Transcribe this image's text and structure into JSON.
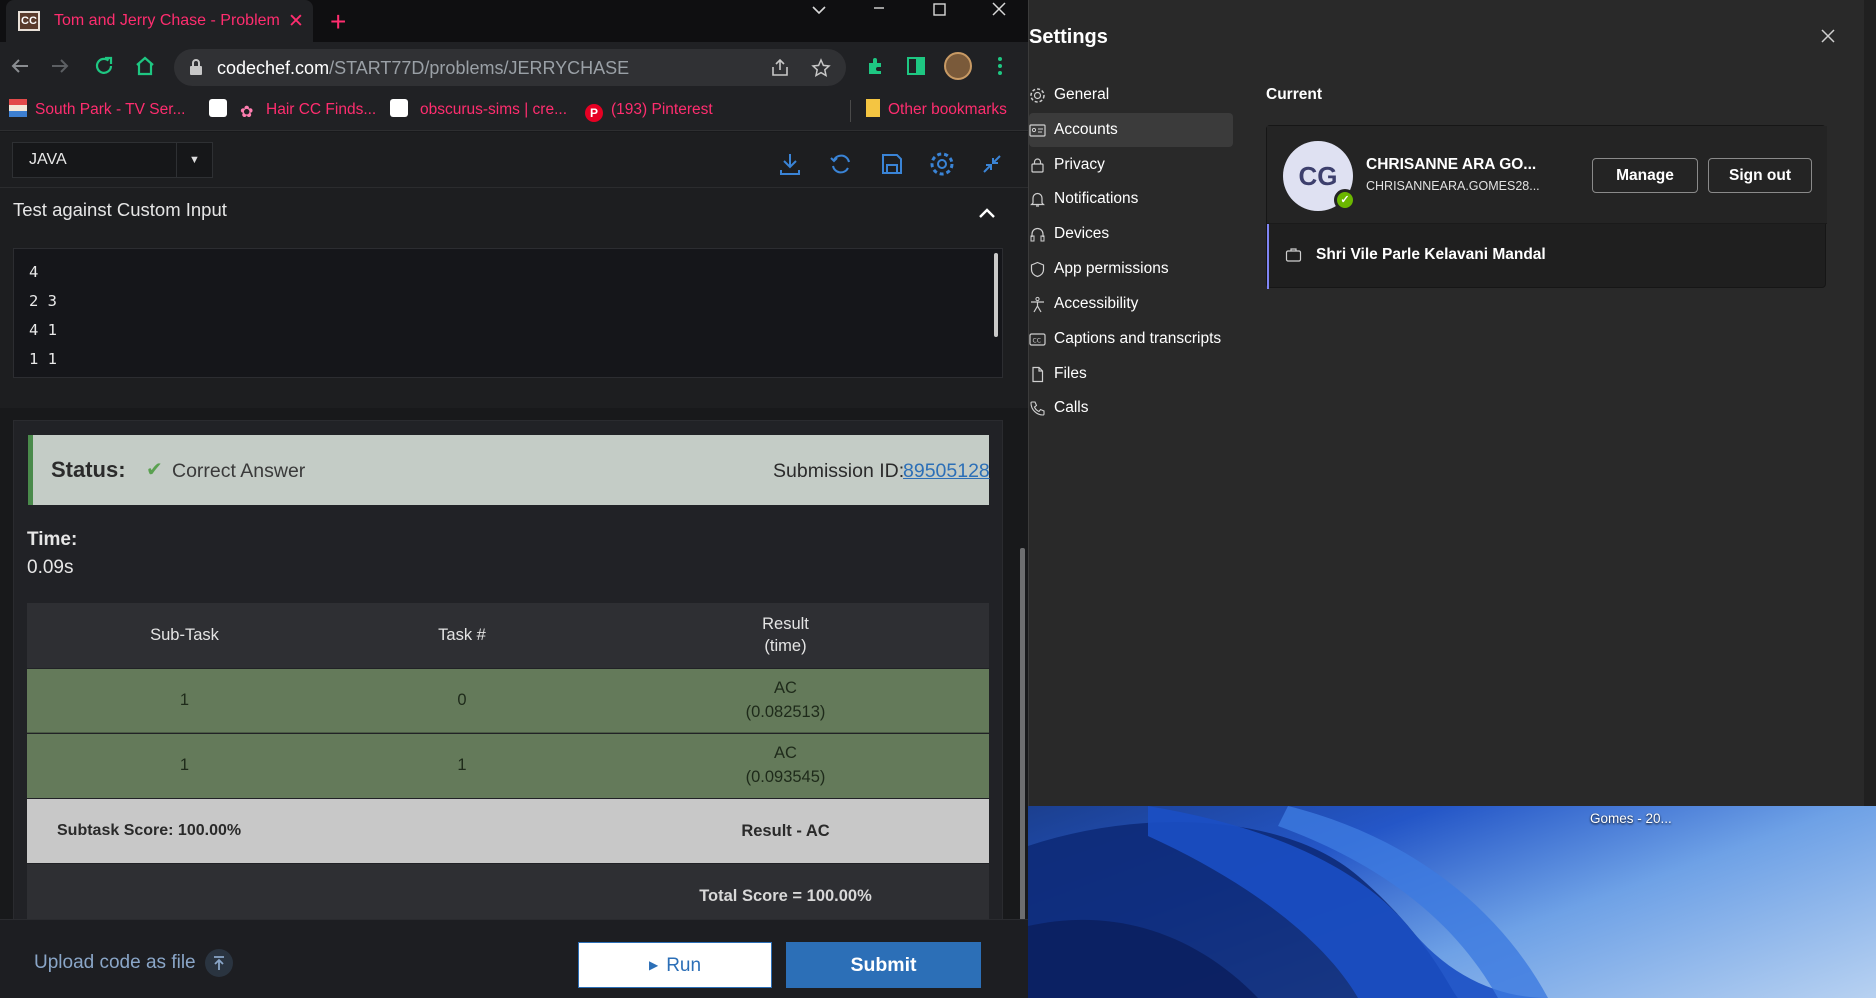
{
  "browser": {
    "tab_title": "Tom and Jerry Chase - Problems",
    "tab_favicon": "CC",
    "address": {
      "host": "codechef.com",
      "path": "/START77D/problems/JERRYCHASE"
    },
    "bookmarks": [
      {
        "label": "South Park - TV Ser...",
        "icon": "south-park-icon"
      },
      {
        "label": "",
        "icon": "patreon-icon"
      },
      {
        "label": "Hair CC Finds...",
        "icon": "flower-icon"
      },
      {
        "label": "",
        "icon": "patreon-icon"
      },
      {
        "label": "obscurus-sims | cre...",
        "icon": "patreon-icon"
      },
      {
        "label": "(193) Pinterest",
        "icon": "pinterest-icon"
      }
    ],
    "other_bookmarks": "Other bookmarks",
    "accent": "#ff2d6f"
  },
  "editor": {
    "language": "JAVA",
    "custom_input_title": "Test against Custom Input",
    "input_lines": [
      "4",
      "2 3",
      "4 1",
      "1 1"
    ]
  },
  "result": {
    "status_label": "Status:",
    "status_value": "Correct Answer",
    "submission_label": "Submission ID:",
    "submission_id": "89505128",
    "time_label": "Time:",
    "time_value": "0.09s",
    "table": {
      "headers": [
        "Sub-Task",
        "Task #",
        "Result"
      ],
      "header_sub": "(time)",
      "rows": [
        {
          "subtask": "1",
          "task": "0",
          "result": "AC",
          "time": "(0.082513)"
        },
        {
          "subtask": "1",
          "task": "1",
          "result": "AC",
          "time": "(0.093545)"
        }
      ],
      "subtask_score": "Subtask Score: 100.00%",
      "subtask_result": "Result - AC",
      "total_score": "Total Score = 100.00%"
    }
  },
  "bottom": {
    "upload": "Upload code as file",
    "run": "Run",
    "submit": "Submit"
  },
  "settings": {
    "title": "Settings",
    "nav": [
      {
        "label": "General",
        "icon": "gear-icon"
      },
      {
        "label": "Accounts",
        "icon": "id-card-icon",
        "active": true
      },
      {
        "label": "Privacy",
        "icon": "lock-icon"
      },
      {
        "label": "Notifications",
        "icon": "bell-icon"
      },
      {
        "label": "Devices",
        "icon": "headset-icon"
      },
      {
        "label": "App permissions",
        "icon": "shield-icon"
      },
      {
        "label": "Accessibility",
        "icon": "accessibility-icon"
      },
      {
        "label": "Captions and transcripts",
        "icon": "cc-icon"
      },
      {
        "label": "Files",
        "icon": "file-icon"
      },
      {
        "label": "Calls",
        "icon": "phone-icon"
      }
    ],
    "current_heading": "Current",
    "account": {
      "initials": "CG",
      "name": "CHRISANNE ARA GO...",
      "email": "CHRISANNEARA.GOMES28...",
      "manage": "Manage",
      "sign_out": "Sign out"
    },
    "organization": "Shri Vile Parle Kelavani Mandal"
  },
  "desktop": {
    "label": "Gomes - 20..."
  }
}
